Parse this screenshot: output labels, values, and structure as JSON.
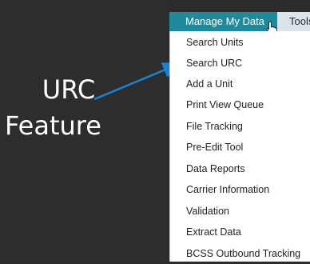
{
  "callout": {
    "line1": "URC",
    "line2": "Feature",
    "arrow_color": "#1a82d4"
  },
  "menubar": {
    "active_tab": "Manage My Data",
    "next_tab": "Tools",
    "accent_color": "#1f8a9c"
  },
  "dropdown": {
    "items": [
      {
        "label": "Search Units"
      },
      {
        "label": "Search URC"
      },
      {
        "label": "Add a Unit"
      },
      {
        "label": "Print View Queue"
      },
      {
        "label": "File Tracking"
      },
      {
        "label": "Pre-Edit Tool"
      },
      {
        "label": "Data Reports"
      },
      {
        "label": "Carrier Information"
      },
      {
        "label": "Validation"
      },
      {
        "label": "Extract Data"
      },
      {
        "label": "BCSS Outbound Tracking"
      }
    ]
  },
  "icons": {
    "cursor": "hand-pointer-icon"
  }
}
